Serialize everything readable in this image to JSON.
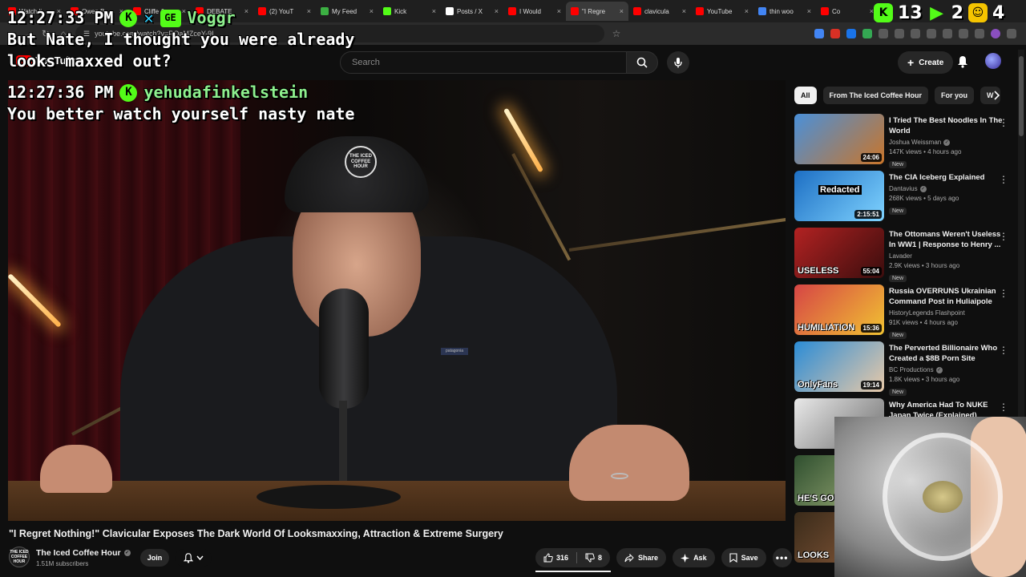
{
  "browser": {
    "tabs": [
      {
        "label": "Watch li",
        "color": "#ff0000"
      },
      {
        "label": "Owen B",
        "color": "#ff0000"
      },
      {
        "label": "Cliffe &",
        "color": "#ff0000"
      },
      {
        "label": "DEBATE",
        "color": "#ff0000"
      },
      {
        "label": "(2) YouT",
        "color": "#ff0000"
      },
      {
        "label": "My Feed",
        "color": "#3cb043"
      },
      {
        "label": "Kick",
        "color": "#53fc18"
      },
      {
        "label": "Posts / X",
        "color": "#ffffff"
      },
      {
        "label": "I Would",
        "color": "#ff0000"
      },
      {
        "label": "\"I Regre",
        "color": "#ff0000",
        "active": true
      },
      {
        "label": "clavicula",
        "color": "#ff0000"
      },
      {
        "label": "YouTube",
        "color": "#ff0000"
      },
      {
        "label": "thin woo",
        "color": "#4285f4"
      },
      {
        "label": "Co",
        "color": "#ff0000"
      }
    ],
    "url": "youtube.com/watch?v=PQaMZceY-9I"
  },
  "youtube": {
    "logo_text": "YouTube",
    "search_placeholder": "Search",
    "create_label": "Create",
    "chips": [
      "All",
      "From The Iced Coffee Hour",
      "For you",
      "W"
    ],
    "video": {
      "title": "\"I Regret Nothing!\" Clavicular Exposes The Dark World Of Looksmaxxing, Attraction & Extreme Surgery",
      "channel": "The Iced Coffee Hour",
      "subscribers": "1.51M subscribers",
      "join_label": "Join",
      "likes": "316",
      "dislikes": "8",
      "share_label": "Share",
      "ask_label": "Ask",
      "save_label": "Save",
      "cap_logo": "THE ICED COFFEE HOUR",
      "avatar_text": "THE ICED COFFEE HOUR",
      "shirt_brand": "patagonia"
    },
    "recommendations": [
      {
        "title": "I Tried The Best Noodles In The World",
        "channel": "Joshua Weissman",
        "verified": true,
        "stats": "147K views • 4 hours ago",
        "badge": "New",
        "duration": "24:06",
        "label": "",
        "thumb_colors": [
          "#4a90d9",
          "#c9752a"
        ]
      },
      {
        "title": "The CIA Iceberg Explained",
        "channel": "Dantavius",
        "verified": true,
        "stats": "268K views • 5 days ago",
        "badge": "New",
        "duration": "2:15:51",
        "label": "Redacted",
        "thumb_colors": [
          "#1d6fc4",
          "#7fd3ff"
        ]
      },
      {
        "title": "The Ottomans Weren't Useless In WW1 | Response to Henry ...",
        "channel": "Lavader",
        "verified": false,
        "stats": "2.9K views • 3 hours ago",
        "badge": "New",
        "duration": "55:04",
        "label": "USELESS",
        "thumb_colors": [
          "#b22222",
          "#3a0d0d"
        ]
      },
      {
        "title": "Russia OVERRUNS Ukrainian Command Post in Huliaipole",
        "channel": "HistoryLegends Flashpoint",
        "verified": false,
        "stats": "91K views • 4 hours ago",
        "badge": "New",
        "duration": "15:36",
        "label": "HUMILIATION",
        "thumb_colors": [
          "#d64545",
          "#f1c232"
        ]
      },
      {
        "title": "The Perverted Billionaire Who Created a $8B Porn Site",
        "channel": "BC Productions",
        "verified": true,
        "stats": "1.8K views • 3 hours ago",
        "badge": "New",
        "duration": "19:14",
        "label": "OnlyFans",
        "thumb_colors": [
          "#2b8cd6",
          "#e8c9a8"
        ]
      },
      {
        "title": "Why America Had To NUKE Japan Twice (Explained)",
        "channel": "",
        "verified": false,
        "stats": "",
        "badge": "",
        "duration": "",
        "label": "",
        "thumb_colors": [
          "#e9e9e9",
          "#6e6e6e"
        ]
      },
      {
        "title": "",
        "channel": "",
        "verified": false,
        "stats": "",
        "badge": "",
        "duration": "",
        "label": "HE'S GON",
        "thumb_colors": [
          "#2f4f2f",
          "#a0b07a"
        ]
      },
      {
        "title": "",
        "channel": "",
        "verified": false,
        "stats": "",
        "badge": "",
        "duration": "",
        "label": "LOOKS",
        "thumb_colors": [
          "#3a2b1a",
          "#8a5a3a"
        ]
      }
    ]
  },
  "chat_overlay": {
    "messages": [
      {
        "time": "12:27:33 PM",
        "user": "Voggr",
        "user_color": "#8ef08e",
        "badges": [
          "K",
          "x",
          "GE"
        ],
        "text": "But Nate, I thought you were already looks maxxed out?"
      },
      {
        "time": "12:27:36 PM",
        "user": "yehudafinkelstein",
        "user_color": "#8ef08e",
        "badges": [
          "K"
        ],
        "text": "You better watch yourself nasty nate"
      }
    ]
  },
  "overlay_counters": [
    {
      "icon": "K",
      "color": "#53fc18",
      "value": "13"
    },
    {
      "icon": "play",
      "color": "#53fc18",
      "value": "2"
    },
    {
      "icon": "face",
      "color": "#f5c400",
      "value": "4"
    }
  ],
  "colors": {
    "yt_bg": "#0f0f0f",
    "yt_red": "#ff0000",
    "kick_green": "#53fc18"
  }
}
